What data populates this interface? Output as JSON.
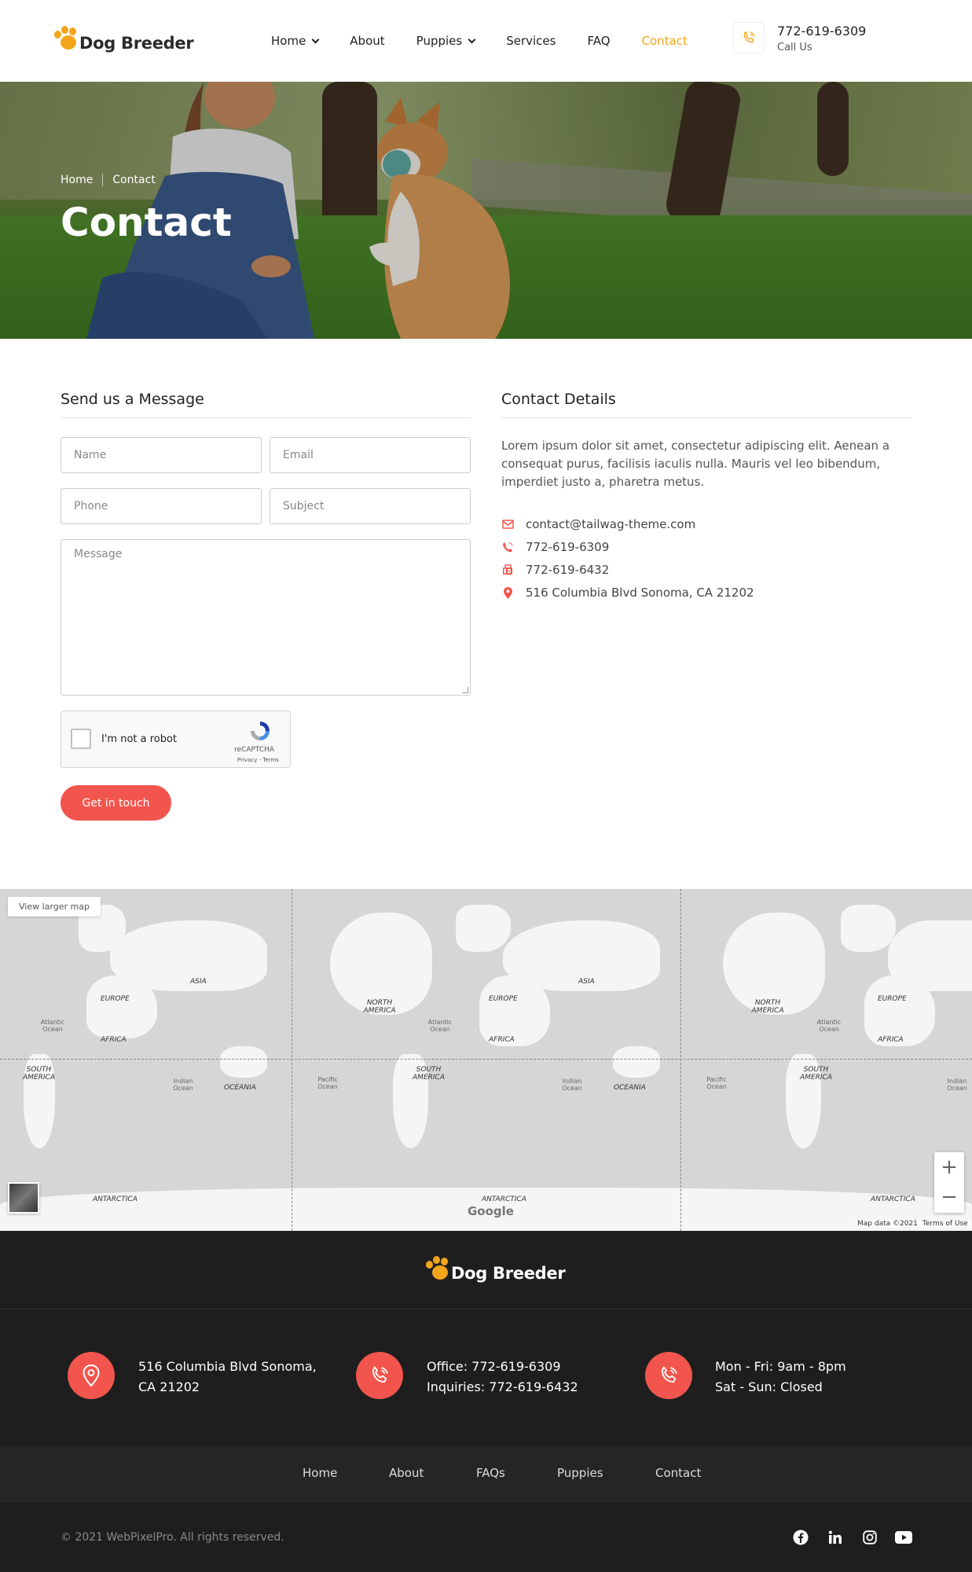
{
  "header": {
    "logo_text": "Dog Breeder",
    "nav": [
      {
        "label": "Home",
        "dropdown": true
      },
      {
        "label": "About",
        "dropdown": false
      },
      {
        "label": "Puppies",
        "dropdown": true
      },
      {
        "label": "Services",
        "dropdown": false
      },
      {
        "label": "FAQ",
        "dropdown": false
      },
      {
        "label": "Contact",
        "dropdown": false,
        "active": true
      }
    ],
    "phone": "772-619-6309",
    "phone_sub": "Call Us"
  },
  "hero": {
    "breadcrumb_home": "Home",
    "breadcrumb_current": "Contact",
    "title": "Contact"
  },
  "form": {
    "title": "Send us a Message",
    "name_placeholder": "Name",
    "email_placeholder": "Email",
    "phone_placeholder": "Phone",
    "subject_placeholder": "Subject",
    "message_placeholder": "Message",
    "captcha_label": "I'm not a robot",
    "captcha_brand": "reCAPTCHA",
    "captcha_links": "Privacy - Terms",
    "submit_label": "Get in touch"
  },
  "details": {
    "title": "Contact Details",
    "text": "Lorem ipsum dolor sit amet, consectetur adipiscing elit. Aenean a consequat purus, facilisis iaculis nulla. Mauris vel leo bibendum, imperdiet justo a, pharetra metus.",
    "email": "contact@tailwag-theme.com",
    "phone": "772-619-6309",
    "fax": "772-619-6432",
    "address": "516 Columbia Blvd Sonoma, CA 21202"
  },
  "map": {
    "view_larger": "View larger map",
    "google": "Google",
    "map_data": "Map data ©2021",
    "terms": "Terms of Use",
    "labels": {
      "europe": "EUROPE",
      "asia": "ASIA",
      "africa": "AFRICA",
      "north_america": "NORTH AMERICA",
      "south_america": "SOUTH AMERICA",
      "oceania": "OCEANIA",
      "antarctica": "ANTARCTICA",
      "atlantic": "Atlantic Ocean",
      "indian": "Indian Ocean",
      "pacific": "Pacific Ocean"
    }
  },
  "footer": {
    "logo_text": "Dog Breeder",
    "address_line1": "516 Columbia Blvd Sonoma,",
    "address_line2": "CA 21202",
    "office": "Office: 772-619-6309",
    "inquiries": "Inquiries: 772-619-6432",
    "hours_weekday": "Mon - Fri: 9am - 8pm",
    "hours_weekend": "Sat - Sun: Closed",
    "links": [
      "Home",
      "About",
      "FAQs",
      "Puppies",
      "Contact"
    ],
    "copyright": "© 2021 WebPixelPro. All rights reserved.",
    "social": [
      "facebook-icon",
      "linkedin-icon",
      "instagram-icon",
      "youtube-icon"
    ]
  },
  "colors": {
    "accent": "#f2554d",
    "brand_yellow": "#f2a51a",
    "footer_bg": "#1e1e1e"
  }
}
